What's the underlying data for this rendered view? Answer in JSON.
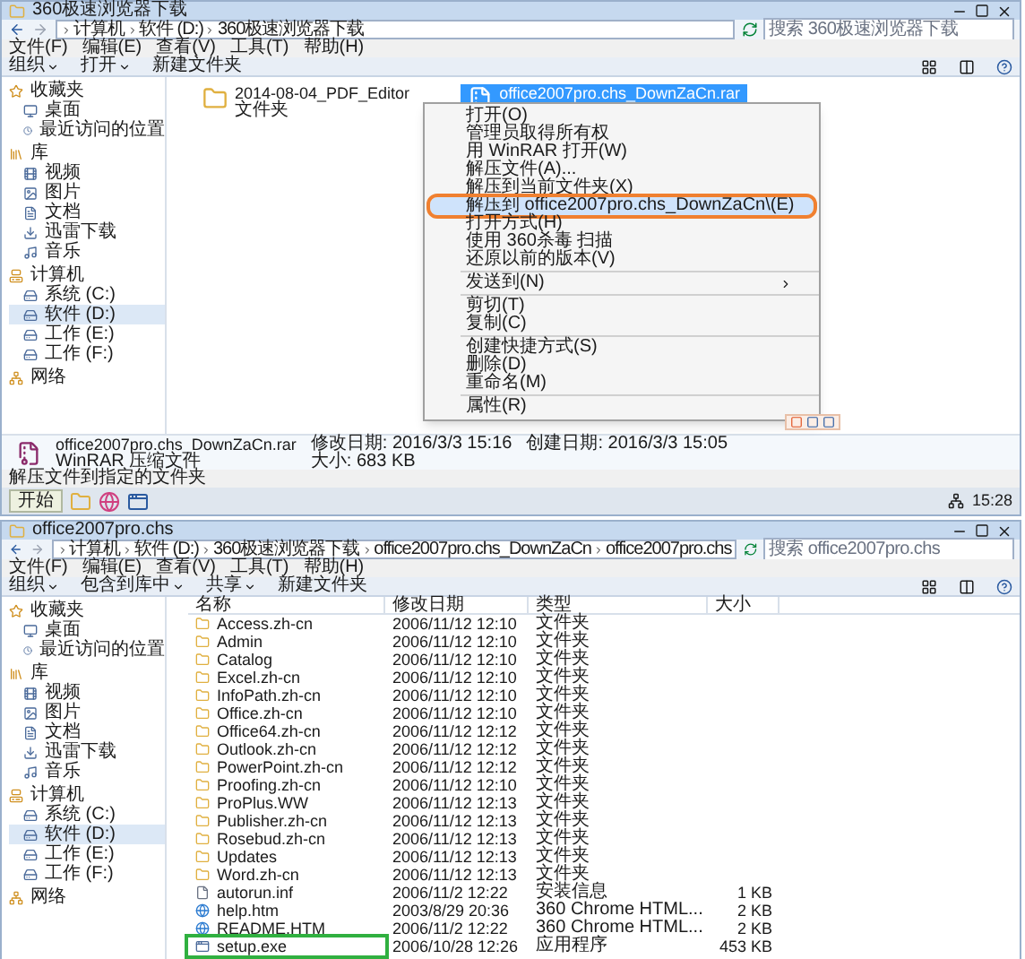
{
  "top_window": {
    "title": "360极速浏览器下载",
    "breadcrumb": [
      "计算机",
      "软件 (D:)",
      "360极速浏览器下载"
    ],
    "search": {
      "placeholder": "搜索 360极速浏览器下载"
    },
    "menu_bar": [
      "文件(F)",
      "编辑(E)",
      "查看(V)",
      "工具(T)",
      "帮助(H)"
    ],
    "toolbar": [
      {
        "label": "组织",
        "dropdown": true
      },
      {
        "label": "打开",
        "dropdown": true
      },
      {
        "label": "新建文件夹",
        "dropdown": false
      }
    ],
    "sidebar": [
      {
        "label": "收藏夹",
        "kind": "favorites",
        "children": [
          {
            "label": "桌面",
            "kind": "desktop",
            "selected": false
          },
          {
            "label": "最近访问的位置",
            "kind": "recent",
            "selected": false
          }
        ]
      },
      {
        "label": "库",
        "kind": "library",
        "children": [
          {
            "label": "视频",
            "kind": "video",
            "selected": false
          },
          {
            "label": "图片",
            "kind": "image",
            "selected": false
          },
          {
            "label": "文档",
            "kind": "document",
            "selected": false
          },
          {
            "label": "迅雷下载",
            "kind": "download",
            "selected": false
          },
          {
            "label": "音乐",
            "kind": "music",
            "selected": false
          }
        ]
      },
      {
        "label": "计算机",
        "kind": "computer",
        "children": [
          {
            "label": "系统 (C:)",
            "kind": "drive",
            "selected": false
          },
          {
            "label": "软件 (D:)",
            "kind": "drive",
            "selected": true
          },
          {
            "label": "工作 (E:)",
            "kind": "drive",
            "selected": false
          },
          {
            "label": "工作 (F:)",
            "kind": "drive",
            "selected": false
          }
        ]
      },
      {
        "label": "网络",
        "kind": "network"
      }
    ],
    "files": [
      {
        "name": "2014-08-04_PDF_Editor",
        "type": "文件夹",
        "kind": "folder",
        "selected": false
      },
      {
        "name": "office2007pro.chs_DownZaCn.rar",
        "kind": "archive",
        "selected": true
      }
    ],
    "context_menu": [
      {
        "kind": "item",
        "label": "打开(O)",
        "highlighted": false
      },
      {
        "kind": "item",
        "label": "管理员取得所有权",
        "highlighted": false
      },
      {
        "kind": "item",
        "label": "用 WinRAR 打开(W)",
        "highlighted": false
      },
      {
        "kind": "item",
        "label": "解压文件(A)...",
        "highlighted": false
      },
      {
        "kind": "item",
        "label": "解压到当前文件夹(X)",
        "highlighted": false
      },
      {
        "kind": "item",
        "label": "解压到 office2007pro.chs_DownZaCn\\(E)",
        "highlighted": true
      },
      {
        "kind": "item",
        "label": "打开方式(H)",
        "highlighted": false
      },
      {
        "kind": "item",
        "label": "使用 360杀毒 扫描",
        "highlighted": false
      },
      {
        "kind": "item",
        "label": "还原以前的版本(V)",
        "highlighted": false
      },
      {
        "kind": "separator"
      },
      {
        "kind": "submenu",
        "label": "发送到(N)",
        "highlighted": false
      },
      {
        "kind": "separator"
      },
      {
        "kind": "item",
        "label": "剪切(T)",
        "highlighted": false
      },
      {
        "kind": "item",
        "label": "复制(C)",
        "highlighted": false
      },
      {
        "kind": "separator"
      },
      {
        "kind": "item",
        "label": "创建快捷方式(S)",
        "highlighted": false
      },
      {
        "kind": "item",
        "label": "删除(D)",
        "highlighted": false
      },
      {
        "kind": "item",
        "label": "重命名(M)",
        "highlighted": false
      },
      {
        "kind": "separator"
      },
      {
        "kind": "item",
        "label": "属性(R)",
        "highlighted": false
      }
    ],
    "details": {
      "name": "office2007pro.chs_DownZaCn.rar",
      "type": "WinRAR 压缩文件",
      "modified": "修改日期: 2016/3/3 15:16",
      "size": "大小: 683 KB",
      "created": "创建日期: 2016/3/3 15:05"
    },
    "status_bar": "解压文件到指定的文件夹",
    "taskbar": {
      "start": "开始",
      "clock": "15:28"
    }
  },
  "bottom_window": {
    "title": "office2007pro.chs",
    "breadcrumb": [
      "计算机",
      "软件 (D:)",
      "360极速浏览器下载",
      "office2007pro.chs_DownZaCn",
      "office2007pro.chs"
    ],
    "search": {
      "placeholder": "搜索 office2007pro.chs"
    },
    "menu_bar": [
      "文件(F)",
      "编辑(E)",
      "查看(V)",
      "工具(T)",
      "帮助(H)"
    ],
    "toolbar": [
      {
        "label": "组织",
        "dropdown": true
      },
      {
        "label": "包含到库中",
        "dropdown": true
      },
      {
        "label": "共享",
        "dropdown": true
      },
      {
        "label": "新建文件夹",
        "dropdown": false
      }
    ],
    "sidebar": [
      {
        "label": "收藏夹",
        "kind": "favorites",
        "children": [
          {
            "label": "桌面",
            "kind": "desktop",
            "selected": false
          },
          {
            "label": "最近访问的位置",
            "kind": "recent",
            "selected": false
          }
        ]
      },
      {
        "label": "库",
        "kind": "library",
        "children": [
          {
            "label": "视频",
            "kind": "video",
            "selected": false
          },
          {
            "label": "图片",
            "kind": "image",
            "selected": false
          },
          {
            "label": "文档",
            "kind": "document",
            "selected": false
          },
          {
            "label": "迅雷下载",
            "kind": "download",
            "selected": false
          },
          {
            "label": "音乐",
            "kind": "music",
            "selected": false
          }
        ]
      },
      {
        "label": "计算机",
        "kind": "computer",
        "children": [
          {
            "label": "系统 (C:)",
            "kind": "drive",
            "selected": false
          },
          {
            "label": "软件 (D:)",
            "kind": "drive",
            "selected": true
          },
          {
            "label": "工作 (E:)",
            "kind": "drive",
            "selected": false
          },
          {
            "label": "工作 (F:)",
            "kind": "drive",
            "selected": false
          }
        ]
      },
      {
        "label": "网络",
        "kind": "network"
      }
    ],
    "columns": [
      "名称",
      "修改日期",
      "类型",
      "大小"
    ],
    "rows": [
      {
        "kind": "folder",
        "name": "Access.zh-cn",
        "date": "2006/11/12 12:10",
        "type": "文件夹",
        "highlighted": false
      },
      {
        "kind": "folder",
        "name": "Admin",
        "date": "2006/11/12 12:10",
        "type": "文件夹",
        "highlighted": false
      },
      {
        "kind": "folder",
        "name": "Catalog",
        "date": "2006/11/12 12:10",
        "type": "文件夹",
        "highlighted": false
      },
      {
        "kind": "folder",
        "name": "Excel.zh-cn",
        "date": "2006/11/12 12:10",
        "type": "文件夹",
        "highlighted": false
      },
      {
        "kind": "folder",
        "name": "InfoPath.zh-cn",
        "date": "2006/11/12 12:10",
        "type": "文件夹",
        "highlighted": false
      },
      {
        "kind": "folder",
        "name": "Office.zh-cn",
        "date": "2006/11/12 12:10",
        "type": "文件夹",
        "highlighted": false
      },
      {
        "kind": "folder",
        "name": "Office64.zh-cn",
        "date": "2006/11/12 12:12",
        "type": "文件夹",
        "highlighted": false
      },
      {
        "kind": "folder",
        "name": "Outlook.zh-cn",
        "date": "2006/11/12 12:12",
        "type": "文件夹",
        "highlighted": false
      },
      {
        "kind": "folder",
        "name": "PowerPoint.zh-cn",
        "date": "2006/11/12 12:12",
        "type": "文件夹",
        "highlighted": false
      },
      {
        "kind": "folder",
        "name": "Proofing.zh-cn",
        "date": "2006/11/12 12:10",
        "type": "文件夹",
        "highlighted": false
      },
      {
        "kind": "folder",
        "name": "ProPlus.WW",
        "date": "2006/11/12 12:13",
        "type": "文件夹",
        "highlighted": false
      },
      {
        "kind": "folder",
        "name": "Publisher.zh-cn",
        "date": "2006/11/12 12:13",
        "type": "文件夹",
        "highlighted": false
      },
      {
        "kind": "folder",
        "name": "Rosebud.zh-cn",
        "date": "2006/11/12 12:13",
        "type": "文件夹",
        "highlighted": false
      },
      {
        "kind": "folder",
        "name": "Updates",
        "date": "2006/11/12 12:13",
        "type": "文件夹",
        "highlighted": false
      },
      {
        "kind": "folder",
        "name": "Word.zh-cn",
        "date": "2006/11/12 12:13",
        "type": "文件夹",
        "highlighted": false
      },
      {
        "kind": "file",
        "name": "autorun.inf",
        "date": "2006/11/2 12:22",
        "type": "安装信息",
        "size": "1 KB",
        "highlighted": false
      },
      {
        "kind": "web",
        "name": "help.htm",
        "date": "2003/8/29 20:36",
        "type": "360 Chrome HTML...",
        "size": "2 KB",
        "highlighted": false
      },
      {
        "kind": "web",
        "name": "README.HTM",
        "date": "2006/11/2 12:22",
        "type": "360 Chrome HTML...",
        "size": "2 KB",
        "highlighted": false
      },
      {
        "kind": "program",
        "name": "setup.exe",
        "date": "2006/10/28 12:26",
        "type": "应用程序",
        "size": "453 KB",
        "highlighted": true
      }
    ]
  }
}
